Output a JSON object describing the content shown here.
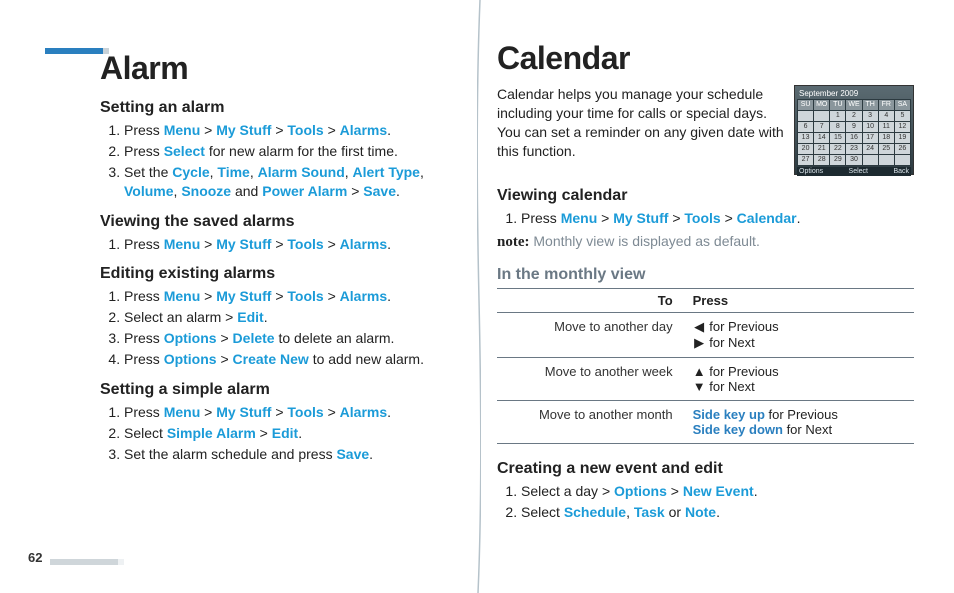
{
  "page_number": "62",
  "left": {
    "title": "Alarm",
    "sections": [
      {
        "heading": "Setting an alarm",
        "items": [
          {
            "prefix": "Press ",
            "seq": [
              "Menu",
              "My Stuff",
              "Tools",
              "Alarms"
            ],
            "suffix": "."
          },
          {
            "prefix": "Press ",
            "seq": [
              "Select"
            ],
            "suffix": " for new alarm for the first time."
          },
          {
            "prefix": "Set the ",
            "list": [
              "Cycle",
              "Time",
              "Alarm Sound",
              "Alert Type",
              "Volume",
              "Snooze"
            ],
            "and": "Power Alarm",
            "then": "Save",
            "suffix": "."
          }
        ]
      },
      {
        "heading": "Viewing the saved alarms",
        "items": [
          {
            "prefix": "Press ",
            "seq": [
              "Menu",
              "My Stuff",
              "Tools",
              "Alarms"
            ],
            "suffix": "."
          }
        ]
      },
      {
        "heading": "Editing existing alarms",
        "items": [
          {
            "prefix": "Press ",
            "seq": [
              "Menu",
              "My Stuff",
              "Tools",
              "Alarms"
            ],
            "suffix": "."
          },
          {
            "prefix": "Select an alarm > ",
            "seq": [
              "Edit"
            ],
            "suffix": "."
          },
          {
            "prefix": "Press ",
            "seq": [
              "Options",
              "Delete"
            ],
            "suffix": " to delete an alarm."
          },
          {
            "prefix": "Press ",
            "seq": [
              "Options",
              "Create New"
            ],
            "suffix": " to add new alarm."
          }
        ]
      },
      {
        "heading": "Setting a simple alarm",
        "items": [
          {
            "prefix": "Press ",
            "seq": [
              "Menu",
              "My Stuff",
              "Tools",
              "Alarms"
            ],
            "suffix": "."
          },
          {
            "prefix": "Select ",
            "seq": [
              "Simple Alarm",
              "Edit"
            ],
            "suffix": "."
          },
          {
            "prefix": "Set the alarm schedule and press ",
            "seq": [
              "Save"
            ],
            "suffix": "."
          }
        ]
      }
    ]
  },
  "right": {
    "title": "Calendar",
    "intro": "Calendar helps you manage your schedule including your time for calls or special days. You can set a reminder on any given date with this function.",
    "viewing": {
      "heading": "Viewing calendar",
      "item": {
        "prefix": "Press ",
        "seq": [
          "Menu",
          "My Stuff",
          "Tools",
          "Calendar"
        ],
        "suffix": "."
      },
      "note_label": "note:",
      "note_body": " Monthly view is displayed as default."
    },
    "sub_heading": "In the monthly view",
    "table": {
      "head_to": "To",
      "head_press": "Press",
      "rows": [
        {
          "to": "Move to another day",
          "press": [
            {
              "sym": "◀",
              "txt": " for Previous"
            },
            {
              "sym": "▶",
              "txt": " for Next"
            }
          ]
        },
        {
          "to": "Move to another week",
          "press": [
            {
              "sym": "▲",
              "txt": " for Previous"
            },
            {
              "sym": "▼",
              "txt": " for Next"
            }
          ]
        },
        {
          "to": "Move to another month",
          "press": [
            {
              "kw": "Side key up",
              "txt": " for Previous"
            },
            {
              "kw": "Side key down",
              "txt": " for Next"
            }
          ]
        }
      ]
    },
    "creating": {
      "heading": "Creating a new event and edit",
      "items": [
        {
          "prefix": "Select a day > ",
          "seq": [
            "Options",
            "New Event"
          ],
          "suffix": "."
        },
        {
          "prefix": "Select ",
          "list": [
            "Schedule",
            "Task"
          ],
          "or": "Note",
          "suffix": "."
        }
      ]
    },
    "phone": {
      "title": "September 2009",
      "weekdays": [
        "SU",
        "MO",
        "TU",
        "WE",
        "TH",
        "FR",
        "SA"
      ],
      "days": [
        [
          "",
          "",
          "1",
          "2",
          "3",
          "4",
          "5"
        ],
        [
          "6",
          "7",
          "8",
          "9",
          "10",
          "11",
          "12"
        ],
        [
          "13",
          "14",
          "15",
          "16",
          "17",
          "18",
          "19"
        ],
        [
          "20",
          "21",
          "22",
          "23",
          "24",
          "25",
          "26"
        ],
        [
          "27",
          "28",
          "29",
          "30",
          "",
          "",
          ""
        ]
      ],
      "softkeys": [
        "Options",
        "Select",
        "Back"
      ]
    }
  }
}
